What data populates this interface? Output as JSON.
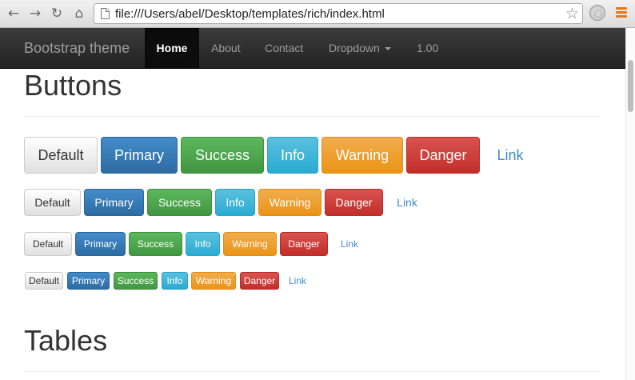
{
  "browser": {
    "url": "file:///Users/abel/Desktop/templates/rich/index.html",
    "icons": [
      "back-icon",
      "forward-icon",
      "reload-icon",
      "home-icon",
      "page-icon",
      "star-icon",
      "extension-icon",
      "menu-icon"
    ]
  },
  "navbar": {
    "brand": "Bootstrap theme",
    "items": [
      {
        "label": "Home",
        "active": true
      },
      {
        "label": "About"
      },
      {
        "label": "Contact"
      },
      {
        "label": "Dropdown"
      },
      {
        "label": "1.00"
      }
    ]
  },
  "sections": {
    "buttons_title": "Buttons",
    "tables_title": "Tables"
  },
  "buttons": {
    "labels": [
      "Default",
      "Primary",
      "Success",
      "Info",
      "Warning",
      "Danger",
      "Link"
    ],
    "sizes": [
      "large",
      "default",
      "small",
      "extra-small"
    ]
  },
  "colors": {
    "primary": "#428bca",
    "success": "#5cb85c",
    "info": "#5bc0de",
    "warning": "#f0ad4e",
    "danger": "#d9534f",
    "navbar": "#222222"
  }
}
